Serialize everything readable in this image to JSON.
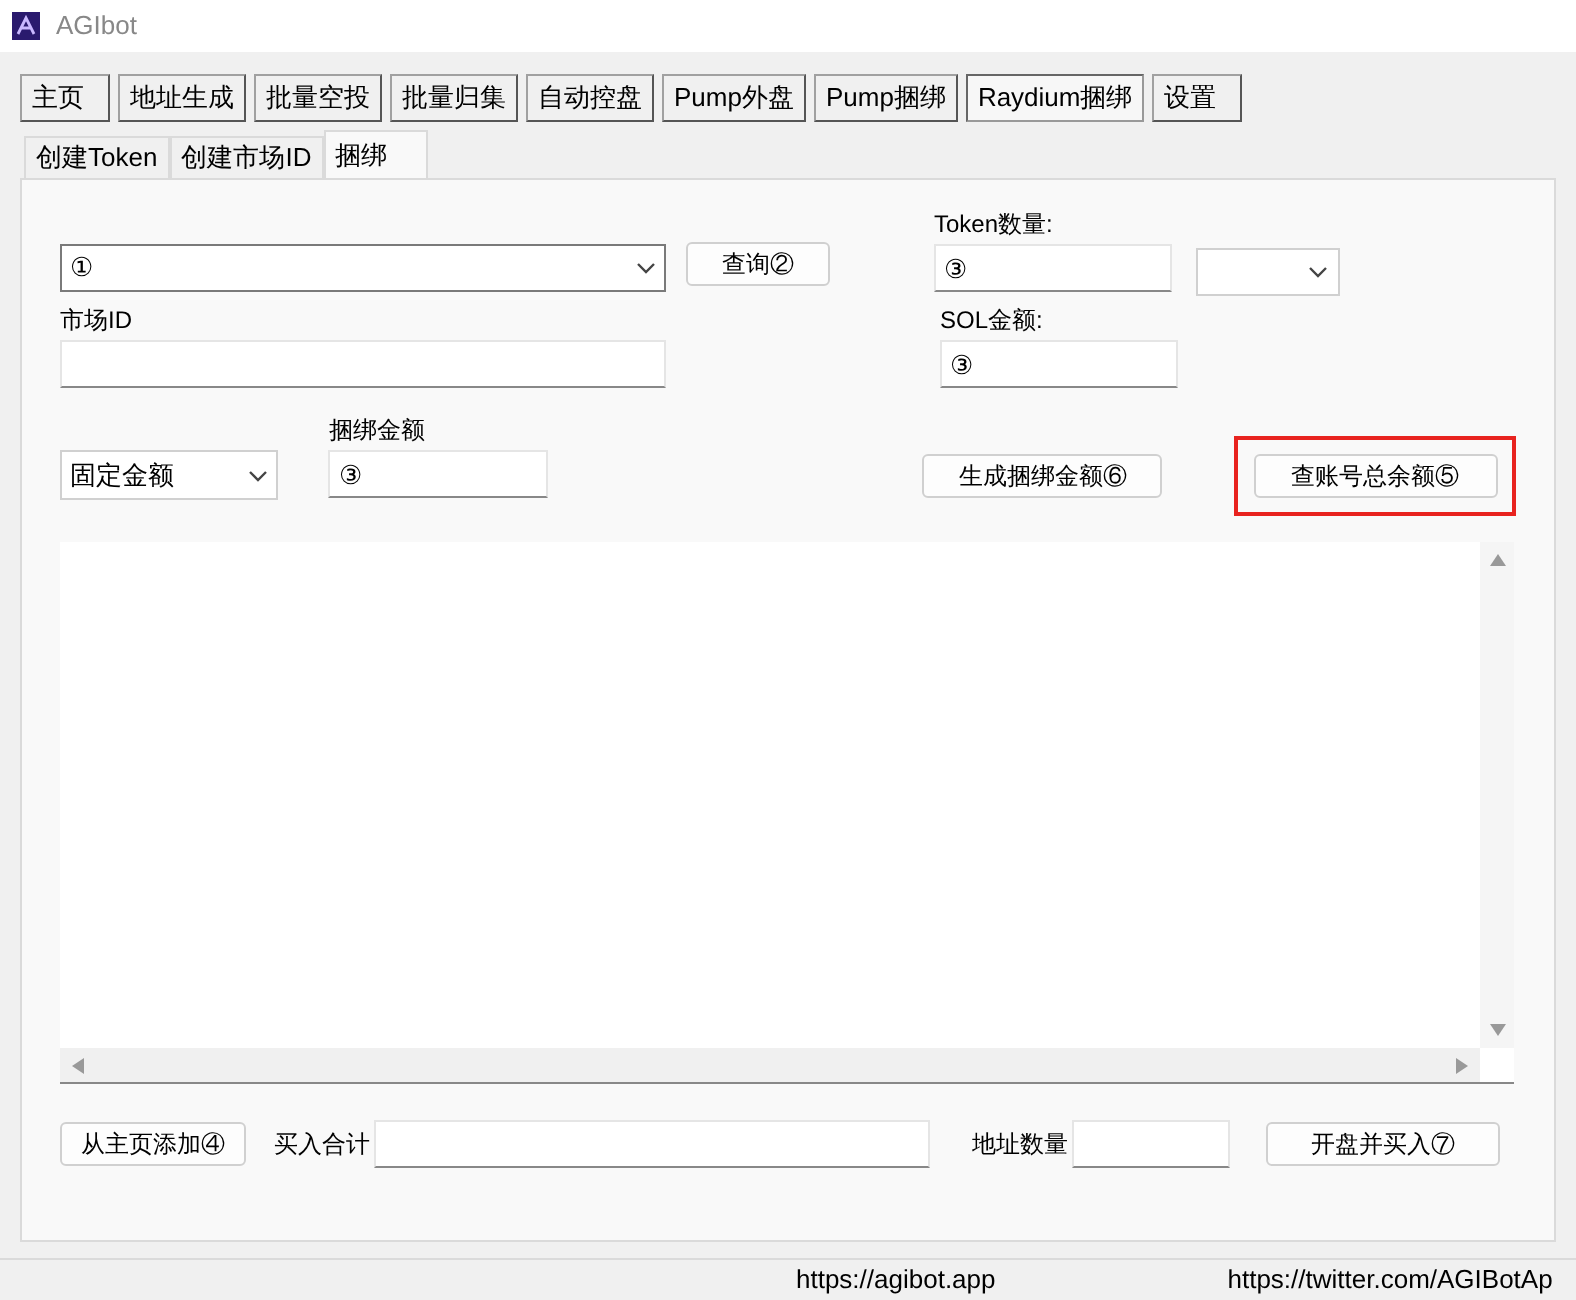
{
  "window": {
    "title": "AGIbot"
  },
  "main_tabs": [
    {
      "label": "主页",
      "selected": false
    },
    {
      "label": "地址生成",
      "selected": false
    },
    {
      "label": "批量空投",
      "selected": false
    },
    {
      "label": "批量归集",
      "selected": false
    },
    {
      "label": "自动控盘",
      "selected": false
    },
    {
      "label": "Pump外盘",
      "selected": false
    },
    {
      "label": "Pump捆绑",
      "selected": false
    },
    {
      "label": "Raydium捆绑",
      "selected": true
    },
    {
      "label": "设置",
      "selected": false
    }
  ],
  "sub_tabs": [
    {
      "label": "创建Token",
      "selected": false
    },
    {
      "label": "创建市场ID",
      "selected": false
    },
    {
      "label": "捆绑",
      "selected": true
    }
  ],
  "form": {
    "token_select": {
      "value": "①"
    },
    "query_button": "查询②",
    "token_amount": {
      "label": "Token数量:",
      "value": "③"
    },
    "market_id": {
      "label": "市场ID"
    },
    "sol_amount": {
      "label": "SOL金额:",
      "value": "③"
    },
    "mode_select": {
      "value": "固定金额"
    },
    "bundle_amount": {
      "label": "捆绑金额",
      "value": "③"
    },
    "generate_button": "生成捆绑金额⑥",
    "balance_button": {
      "label": "查账号总余额⑤",
      "highlighted": true
    },
    "add_button": "从主页添加④",
    "buy_total": {
      "label": "买入合计"
    },
    "address_count": {
      "label": "地址数量"
    },
    "launch_button": "开盘并买入⑦"
  },
  "status_bar": [
    "https://agibot.app",
    "https://twitter.com/AGIBotAp"
  ]
}
